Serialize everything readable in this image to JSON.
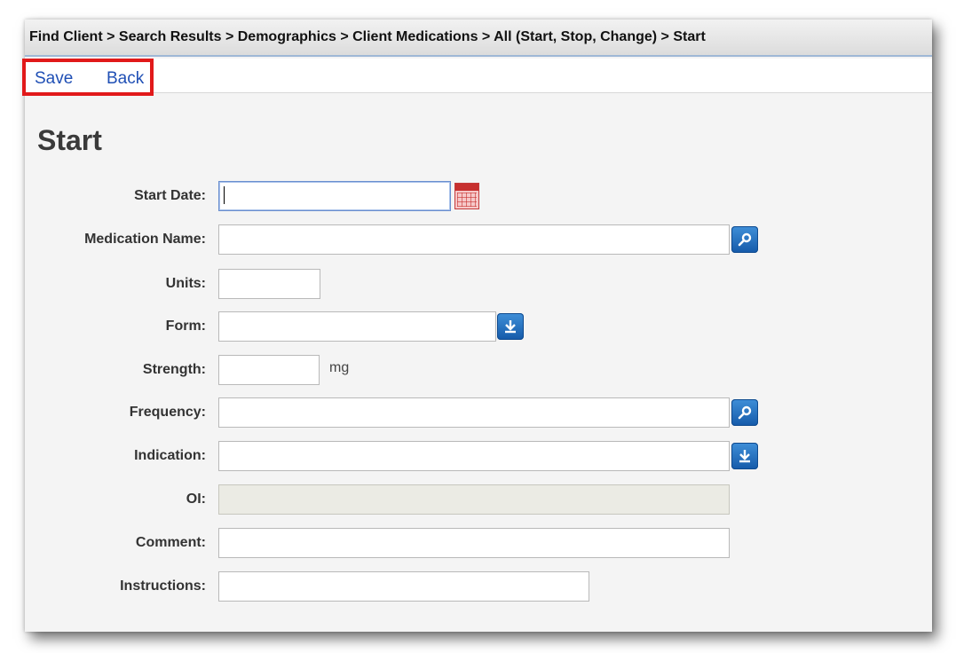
{
  "breadcrumb": {
    "text": "Find Client > Search Results > Demographics > Client Medications > All (Start, Stop, Change) > Start"
  },
  "toolbar": {
    "save_label": "Save",
    "back_label": "Back"
  },
  "page": {
    "title": "Start"
  },
  "form": {
    "start_date": {
      "label": "Start Date:",
      "value": ""
    },
    "medication_name": {
      "label": "Medication Name:",
      "value": ""
    },
    "units": {
      "label": "Units:",
      "value": ""
    },
    "form_field": {
      "label": "Form:",
      "value": ""
    },
    "strength": {
      "label": "Strength:",
      "value": "",
      "unit": "mg"
    },
    "frequency": {
      "label": "Frequency:",
      "value": ""
    },
    "indication": {
      "label": "Indication:",
      "value": ""
    },
    "oi": {
      "label": "OI:",
      "value": ""
    },
    "comment": {
      "label": "Comment:",
      "value": ""
    },
    "instructions": {
      "label": "Instructions:",
      "value": ""
    }
  },
  "icons": {
    "calendar": "calendar-icon",
    "search": "search-icon",
    "dropdown": "download-arrow-icon"
  },
  "colors": {
    "link": "#1f4fb5",
    "highlight_box": "#e1191a",
    "icon_button": "#1a64b5"
  }
}
